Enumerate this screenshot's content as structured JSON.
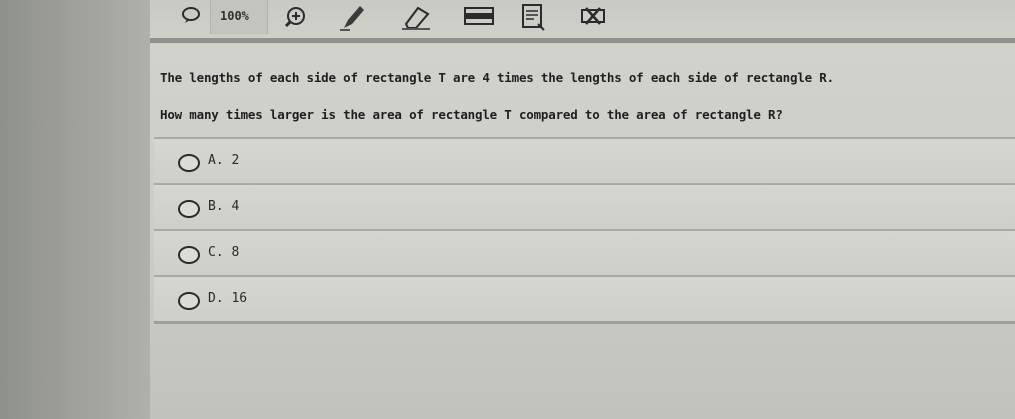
{
  "toolbar": {
    "zoom_label": "100%",
    "icons": [
      "chat-bubble-icon",
      "zoom-in-icon",
      "pencil-icon",
      "eraser-icon",
      "line-reader-icon",
      "notes-icon",
      "eliminate-choice-icon"
    ]
  },
  "question": {
    "line1": "The lengths of each side of rectangle T are 4 times the lengths of each side of rectangle R.",
    "line2": "How many times larger is the area of rectangle T compared to the area of rectangle R?"
  },
  "choices": [
    {
      "letter": "A.",
      "value": "2"
    },
    {
      "letter": "B.",
      "value": "4"
    },
    {
      "letter": "C.",
      "value": "8"
    },
    {
      "letter": "D.",
      "value": "16"
    }
  ]
}
